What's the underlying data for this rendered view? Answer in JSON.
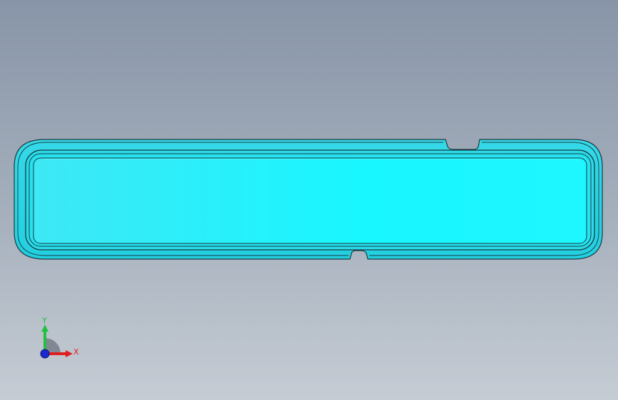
{
  "viewport": {
    "background_top": "#8895a8",
    "background_bottom": "#c6ccd4"
  },
  "part": {
    "face_color": "#1ef7ff",
    "edge_color": "#1a3a40",
    "rim_color": "#2ee0ef"
  },
  "triad": {
    "x_label": "X",
    "y_label": "Y",
    "x_color": "#e02020",
    "y_color": "#20c040",
    "origin_color": "#1a2ad0"
  }
}
